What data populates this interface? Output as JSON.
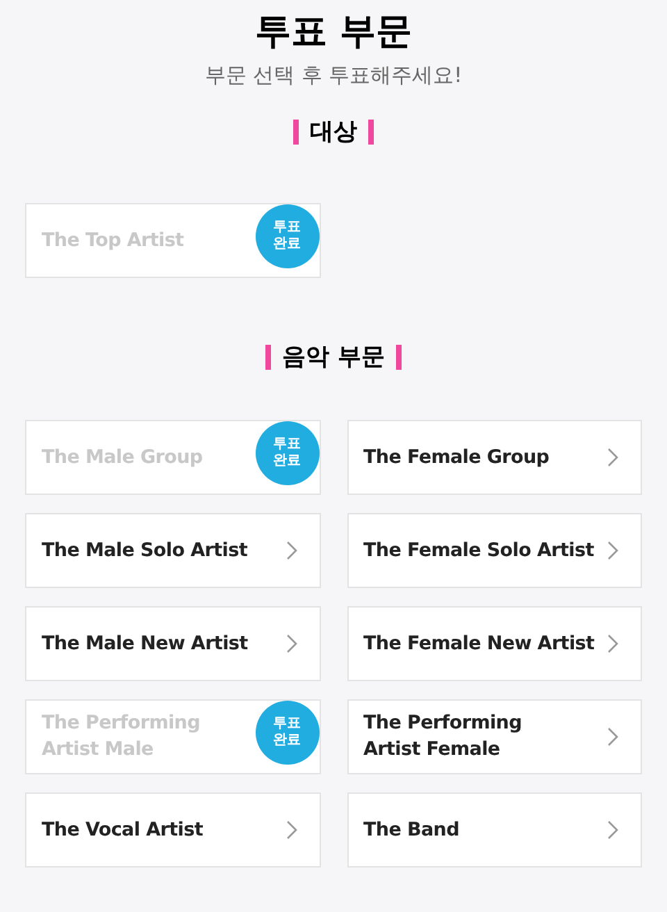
{
  "header": {
    "title": "투표 부문",
    "subtitle": "부문 선택 후 투표해주세요!"
  },
  "sections": [
    {
      "heading": "대상",
      "items": [
        {
          "label": "The Top Artist",
          "voted": true,
          "badge": "투표\n완료"
        }
      ]
    },
    {
      "heading": "음악 부문",
      "items": [
        {
          "label": "The Male Group",
          "voted": true,
          "badge": "투표\n완료"
        },
        {
          "label": "The Female Group",
          "voted": false
        },
        {
          "label": "The Male Solo Artist",
          "voted": false
        },
        {
          "label": "The Female Solo Artist",
          "voted": false
        },
        {
          "label": "The Male New Artist",
          "voted": false
        },
        {
          "label": "The Female New Artist",
          "voted": false
        },
        {
          "label": "The Performing\nArtist Male",
          "voted": true,
          "badge": "투표\n완료"
        },
        {
          "label": "The Performing\nArtist Female",
          "voted": false
        },
        {
          "label": "The Vocal Artist",
          "voted": false
        },
        {
          "label": "The Band",
          "voted": false
        }
      ]
    }
  ]
}
